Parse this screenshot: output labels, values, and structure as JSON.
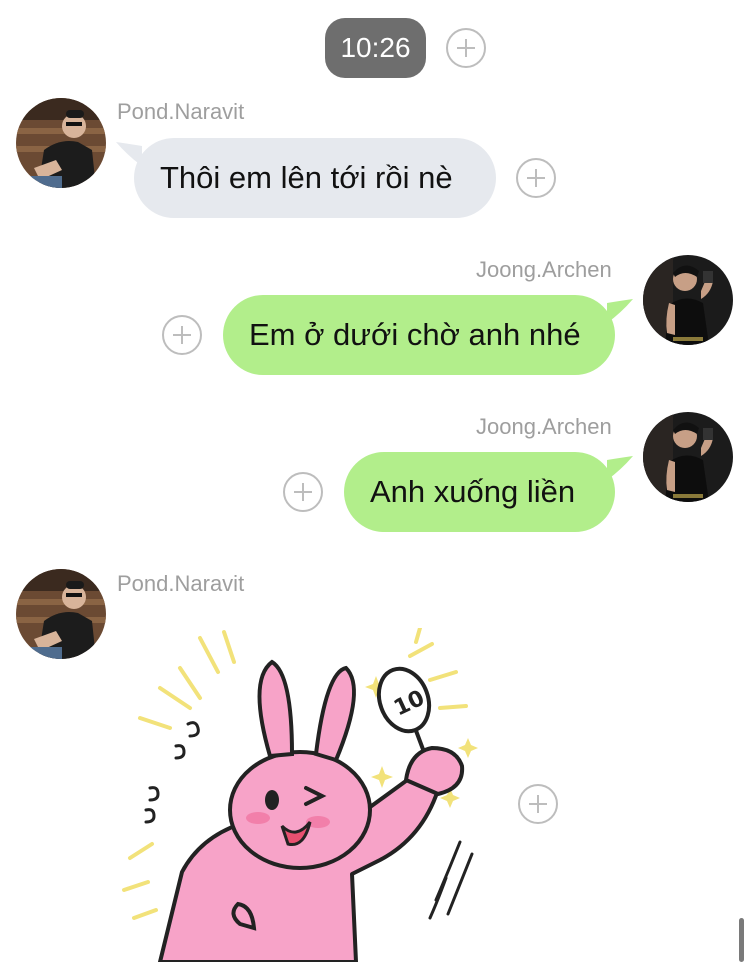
{
  "timestamp": "10:26",
  "messages": [
    {
      "sender": "Pond.Naravit",
      "direction": "incoming",
      "type": "text",
      "text": "Thôi em lên tới rồi nè"
    },
    {
      "sender": "Joong.Archen",
      "direction": "outgoing",
      "type": "text",
      "text": "Em ở dưới chờ anh nhé"
    },
    {
      "sender": "Joong.Archen",
      "direction": "outgoing",
      "type": "text",
      "text": "Anh xuống liền"
    },
    {
      "sender": "Pond.Naravit",
      "direction": "incoming",
      "type": "sticker",
      "sticker_text": "10"
    }
  ],
  "icons": {
    "add": "plus-circle-icon",
    "avatar_incoming": "avatar-pond",
    "avatar_outgoing": "avatar-joong"
  },
  "colors": {
    "incoming_bubble": "#e6e9ee",
    "outgoing_bubble": "#b2ee8b",
    "timestamp_pill": "#6e6e6e",
    "sender_name": "#9e9e9e",
    "sticker_pink": "#f7a3c8"
  }
}
